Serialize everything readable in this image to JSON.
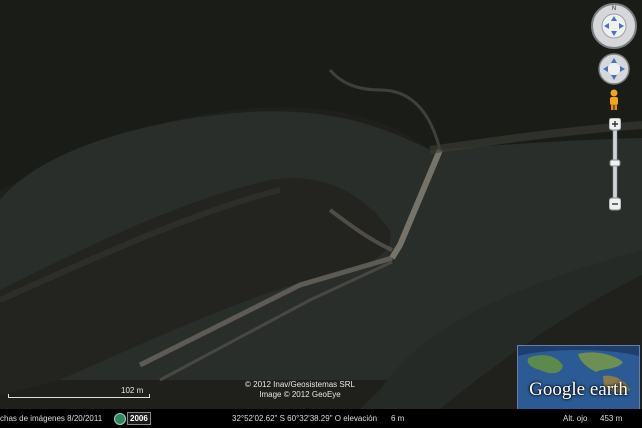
{
  "credits": {
    "line1": "© 2012 Inav/Geosistemas SRL",
    "line2": "Image © 2012 GeoEye"
  },
  "scale": {
    "label": "102 m"
  },
  "status": {
    "imagery_date": "chas de imágenes  8/20/2011",
    "year": "2006",
    "coordinates": "32°52'02.62\" S  60°32'38.29\" O elevación",
    "elevation": "6 m",
    "eye_label": "Alt. ojo",
    "eye_value": "453 m"
  },
  "logo": {
    "text": "Google earth"
  },
  "icons": {
    "look": "look-around-joystick-icon",
    "move": "move-joystick-icon",
    "pegman": "street-view-pegman-icon",
    "zoom_in": "zoom-in-icon",
    "zoom_out": "zoom-out-icon"
  },
  "colors": {
    "river": "#2b2f2d",
    "land": "#22231f",
    "dike": "#8a857a",
    "status_bg": "#000000"
  }
}
